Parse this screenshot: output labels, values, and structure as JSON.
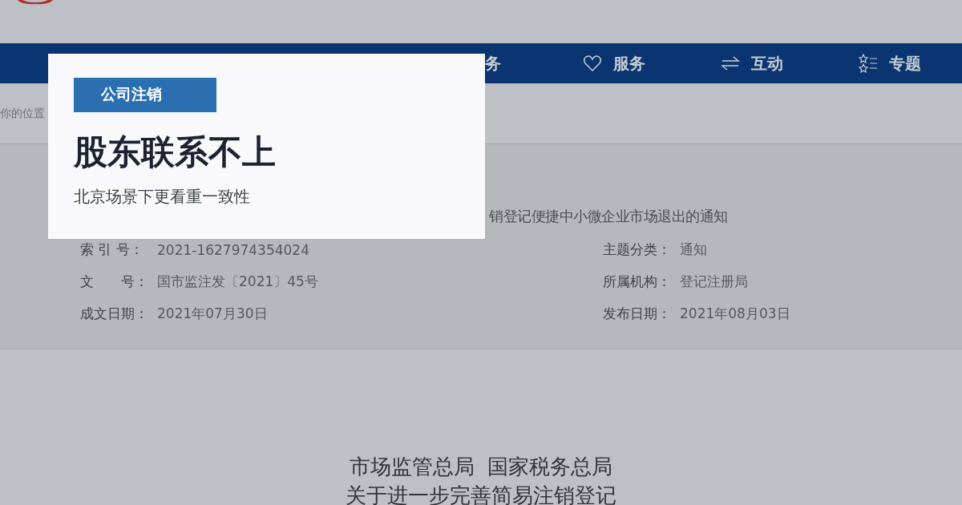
{
  "nav": [
    {
      "label": "务"
    },
    {
      "label": "服务"
    },
    {
      "label": "互动"
    },
    {
      "label": "专题"
    }
  ],
  "breadcrumb": "你的位置",
  "document": {
    "title": "销登记便捷中小微企业市场退出的通知",
    "fields": [
      {
        "label": "索 引 号：",
        "value": "2021-1627974354024"
      },
      {
        "label": "主题分类：",
        "value": "通知"
      },
      {
        "label": "文　　号：",
        "value": "国市监注发〔2021〕45号"
      },
      {
        "label": "所属机构：",
        "value": "登记注册局"
      },
      {
        "label": "成文日期：",
        "value": "2021年07月30日"
      },
      {
        "label": "发布日期：",
        "value": "2021年08月03日"
      }
    ],
    "heading": [
      "市场监管总局  国家税务总局",
      "关于进一步完善简易注销登记"
    ]
  },
  "card": {
    "tag": "公司注销",
    "title": "股东联系不上",
    "subtitle": "北京场景下更看重一致性"
  }
}
